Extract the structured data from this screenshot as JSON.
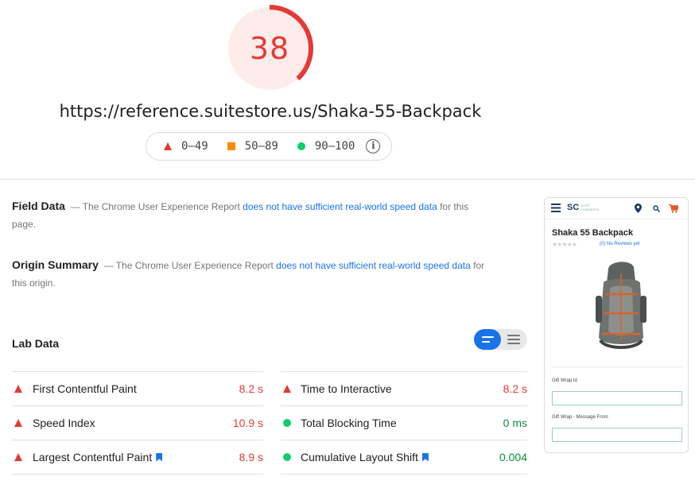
{
  "score": {
    "value": "38",
    "fraction": 0.38,
    "color": "#e53935"
  },
  "url": "https://reference.suitestore.us/Shaka-55-Backpack",
  "legend": {
    "fail": "0–49",
    "average": "50–89",
    "pass": "90–100",
    "info_icon": "info-icon"
  },
  "field_data": {
    "title": "Field Data",
    "dash": "—",
    "text_before": "The Chrome User Experience Report",
    "link": "does not have sufficient real-world speed data",
    "text_after": "for this page."
  },
  "origin_summary": {
    "title": "Origin Summary",
    "dash": "—",
    "text_before": "The Chrome User Experience Report",
    "link": "does not have sufficient real-world speed data",
    "text_after": "for this origin."
  },
  "lab_data": {
    "title": "Lab Data",
    "metrics_left": [
      {
        "label": "First Contentful Paint",
        "value": "8.2 s",
        "status": "fail",
        "bookmark": false
      },
      {
        "label": "Speed Index",
        "value": "10.9 s",
        "status": "fail",
        "bookmark": false
      },
      {
        "label": "Largest Contentful Paint",
        "value": "8.9 s",
        "status": "fail",
        "bookmark": true
      }
    ],
    "metrics_right": [
      {
        "label": "Time to Interactive",
        "value": "8.2 s",
        "status": "fail",
        "bookmark": false
      },
      {
        "label": "Total Blocking Time",
        "value": "0 ms",
        "status": "pass",
        "bookmark": false
      },
      {
        "label": "Cumulative Layout Shift",
        "value": "0.004",
        "status": "pass",
        "bookmark": true
      }
    ]
  },
  "screenshot": {
    "logo": "SC",
    "logo_small": "SUITE COMMERCE",
    "product_title": "Shaka 55 Backpack",
    "reviews": "(0) No Reviews yet",
    "gift_wrap_id": "Gift Wrap Id",
    "gift_wrap_message": "Gift Wrap - Message From"
  },
  "colors": {
    "fail": "#e53935",
    "pass": "#0cce6b",
    "average": "#fb8c00",
    "link": "#1a73e8"
  }
}
